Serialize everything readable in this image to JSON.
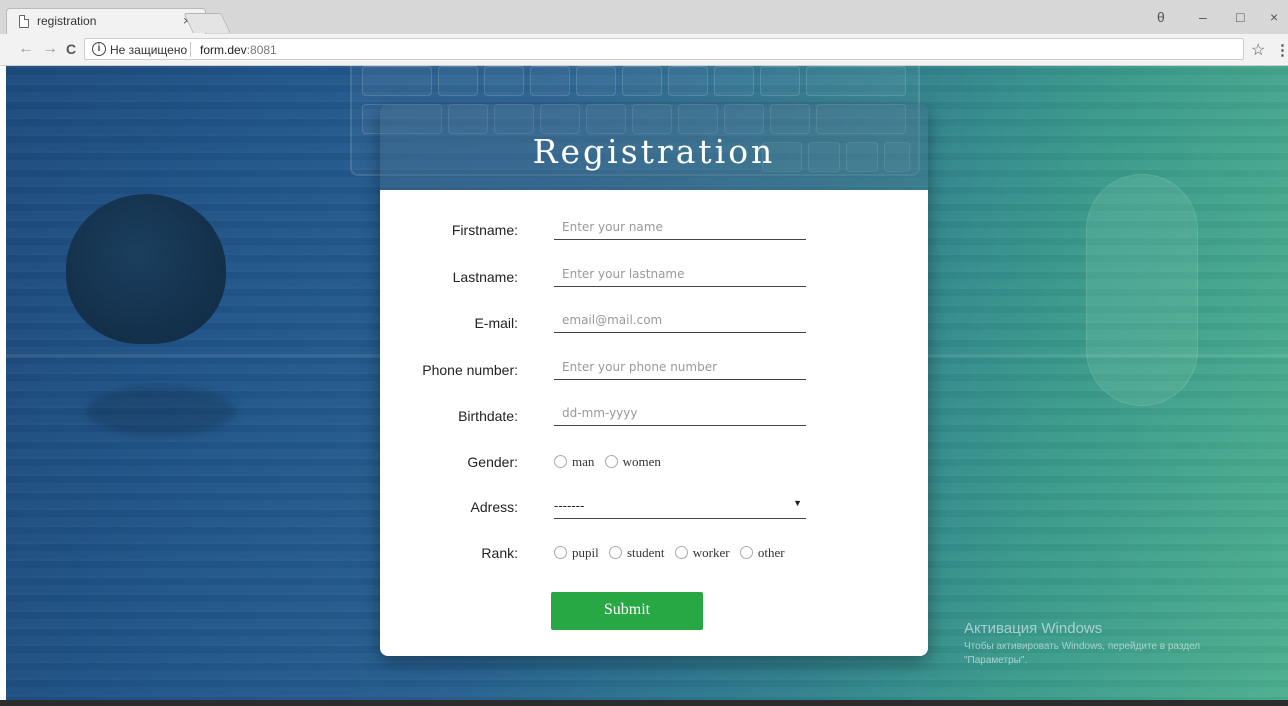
{
  "browser": {
    "tab_title": "registration",
    "tab_close": "×",
    "not_secure": "Не защищено",
    "url_host": "form.dev",
    "url_port": ":8081",
    "back": "←",
    "forward": "→",
    "reload": "C",
    "profile": "θ",
    "minimize": "–",
    "maximize": "□",
    "close": "×",
    "bookmark": "☆",
    "menu": "⋮"
  },
  "form": {
    "title": "Registration",
    "fields": {
      "firstname": {
        "label": "Firstname:",
        "placeholder": "Enter your name"
      },
      "lastname": {
        "label": "Lastname:",
        "placeholder": "Enter your lastname"
      },
      "email": {
        "label": "E-mail:",
        "placeholder": "email@mail.com"
      },
      "phone": {
        "label": "Phone number:",
        "placeholder": "Enter your phone number"
      },
      "birthdate": {
        "label": "Birthdate:",
        "placeholder": "dd-mm-yyyy"
      }
    },
    "gender": {
      "label": "Gender:",
      "options": [
        "man",
        "women"
      ]
    },
    "address": {
      "label": "Adress:",
      "selected": "-------",
      "chevron": "▼"
    },
    "rank": {
      "label": "Rank:",
      "options": [
        "pupil",
        "student",
        "worker",
        "other"
      ]
    },
    "submit_label": "Submit"
  },
  "windows_activation": {
    "title": "Активация Windows",
    "message": "Чтобы активировать Windows, перейдите в раздел \"Параметры\"."
  },
  "colors": {
    "submit": "#28a745",
    "background_left": "#1d4b7d",
    "background_right": "#4cae8e"
  }
}
